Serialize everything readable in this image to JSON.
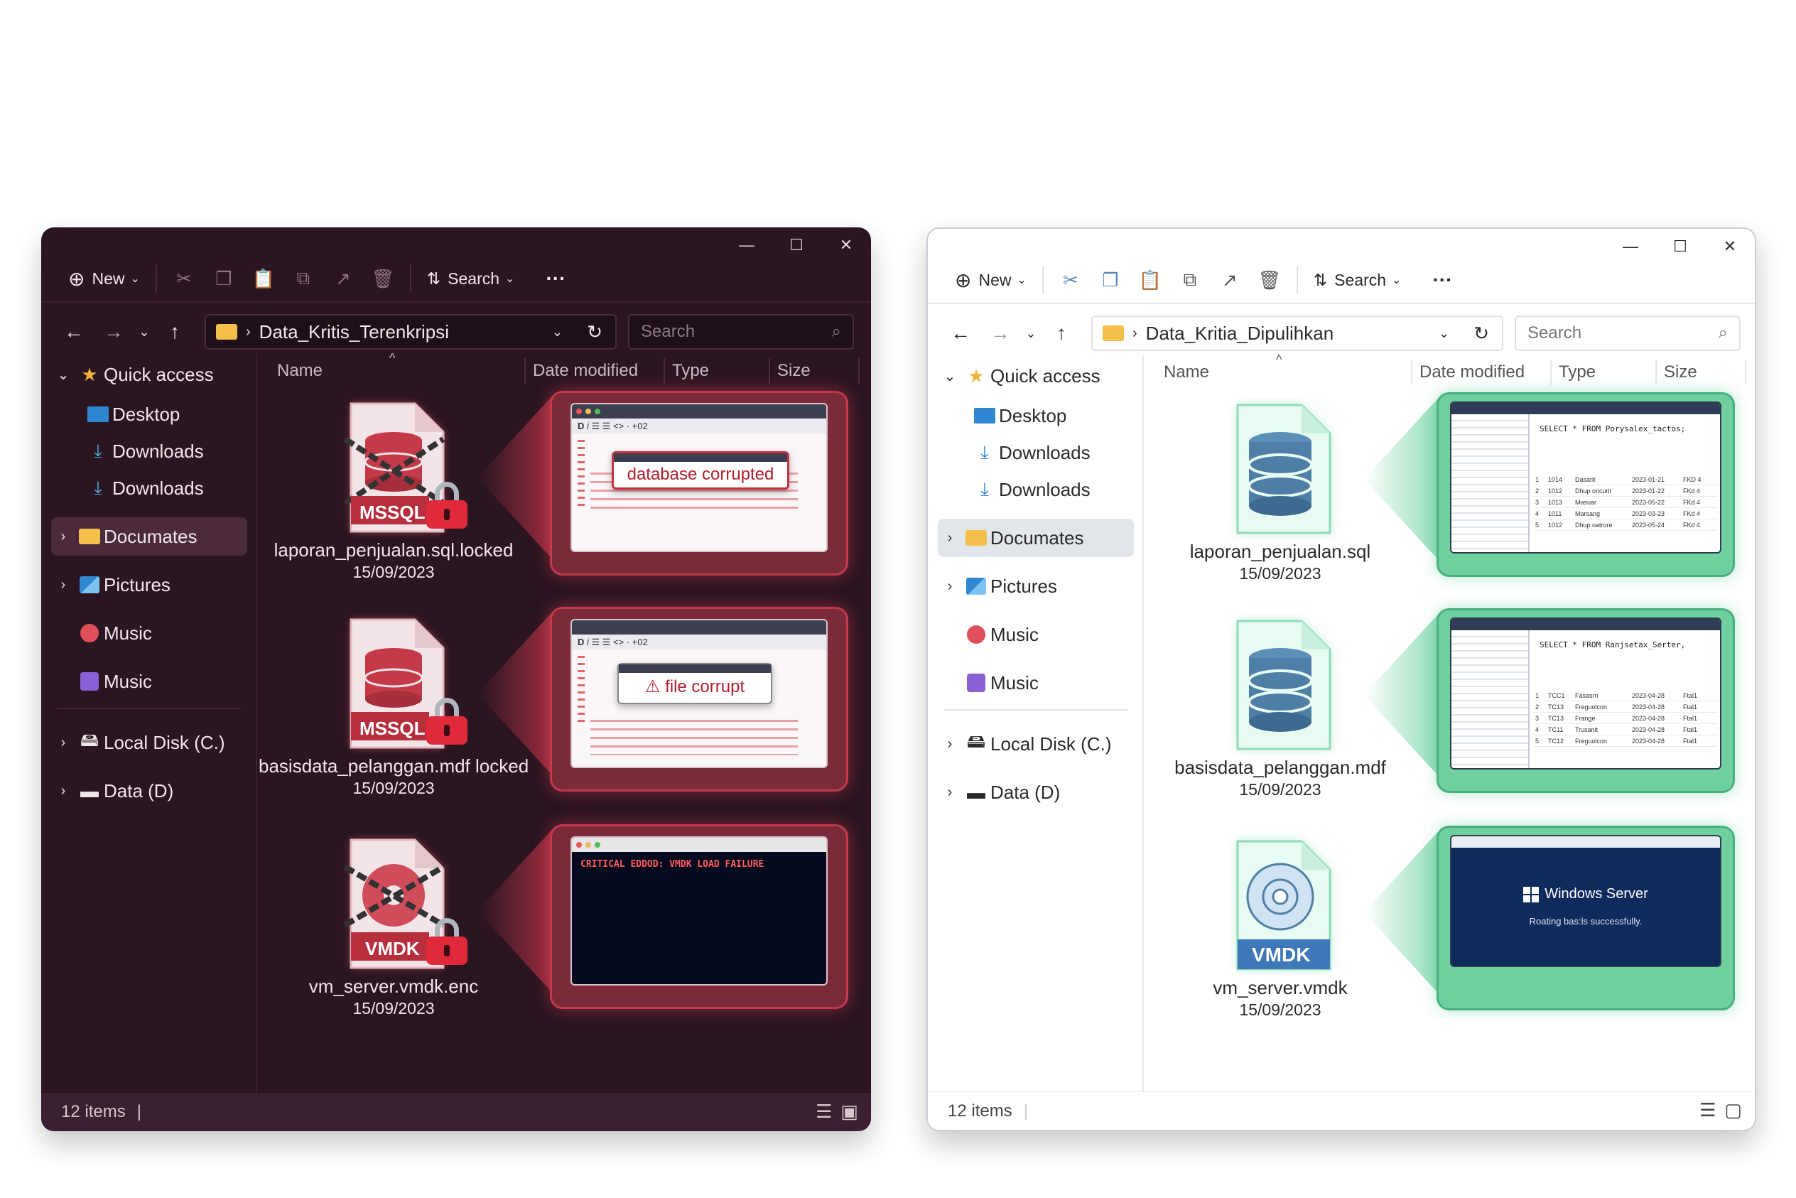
{
  "left": {
    "toolbar": {
      "new": "New",
      "search": "Search",
      "more": "···"
    },
    "path": "Data_Kritis_Terenkripsi",
    "search_placeholder": "Search",
    "columns": {
      "name": "Name",
      "date": "Date modified",
      "type": "Type",
      "size": "Size"
    },
    "sidebar": {
      "quick_access": "Quick access",
      "items": [
        "Desktop",
        "Downloads",
        "Downloads",
        "Documates",
        "Pictures",
        "Music",
        "Music",
        "Local Disk (C.)",
        "Data (D)"
      ]
    },
    "files": [
      {
        "name": "laporan_penjualan.sql.locked",
        "date": "15/09/2023",
        "badge": "MSSQL"
      },
      {
        "name": "basisdata_pelanggan.mdf locked",
        "date": "15/09/2023",
        "badge": "MSSQL"
      },
      {
        "name": "vm_server.vmdk.enc",
        "date": "15/09/2023",
        "badge": "VMDK"
      }
    ],
    "previews": {
      "p1_error": "database corrupted",
      "p2_error": "file corrupt",
      "p3_error": "CRITICAL EDDOD: VMDK LOAD FAILURE",
      "toolbar_misc": "<> · +02"
    },
    "status": "12 items"
  },
  "right": {
    "toolbar": {
      "new": "New",
      "search": "Search",
      "more": "···"
    },
    "path": "Data_Kritia_Dipulihkan",
    "search_placeholder": "Search",
    "columns": {
      "name": "Name",
      "date": "Date modified",
      "type": "Type",
      "size": "Size"
    },
    "sidebar": {
      "quick_access": "Quick access",
      "items": [
        "Desktop",
        "Downloads",
        "Downloads",
        "Documates",
        "Pictures",
        "Music",
        "Music",
        "Local Disk (C.)",
        "Data (D)"
      ]
    },
    "files": [
      {
        "name": "laporan_penjualan.sql",
        "date": "15/09/2023"
      },
      {
        "name": "basisdata_pelanggan.mdf",
        "date": "15/09/2023"
      },
      {
        "name": "vm_server.vmdk",
        "date": "15/09/2023",
        "badge": "VMDK"
      }
    ],
    "previews": {
      "p1_query": "SELECT * FROM Porysalex_tactos;",
      "p2_query": "SELECT * FROM Ranjsetax_Serter,",
      "p1_rows": [
        [
          "1",
          "1014",
          "Dasarit",
          "2023-01-21",
          "FKD 4"
        ],
        [
          "2",
          "1012",
          "Dhup oricurit",
          "2023-01-22",
          "FKd 4"
        ],
        [
          "3",
          "1013",
          "Masuar",
          "2023-05-22",
          "FKd 4"
        ],
        [
          "4",
          "1011",
          "Marsang",
          "2023-03-23",
          "FKd 4"
        ],
        [
          "5",
          "1012",
          "Dhup oatrore",
          "2023-05-24",
          "FKd 4"
        ]
      ],
      "p2_rows": [
        [
          "1",
          "TCC1",
          "Fasasrn",
          "2023-04-28",
          "Ftal1"
        ],
        [
          "2",
          "TC13",
          "Freguolcon",
          "2023-04-28",
          "Ftal1"
        ],
        [
          "3",
          "TC13",
          "Frange",
          "2023-04-28",
          "Ftal1"
        ],
        [
          "4",
          "TC11",
          "Trusanit",
          "2023-04-28",
          "Ftal1"
        ],
        [
          "5",
          "TC12",
          "Freguolcon",
          "2023-04-28",
          "Ftal1"
        ]
      ],
      "server_title": "Windows Server",
      "server_msg": "Roating bas:ls successfully."
    },
    "status": "12 items"
  },
  "colors": {
    "dark_bg": "#2a1521",
    "danger": "#d32f3f",
    "callout_red": "#7a2a38",
    "callout_green": "#6fcf9f",
    "server_blue": "#0f2a5c"
  }
}
